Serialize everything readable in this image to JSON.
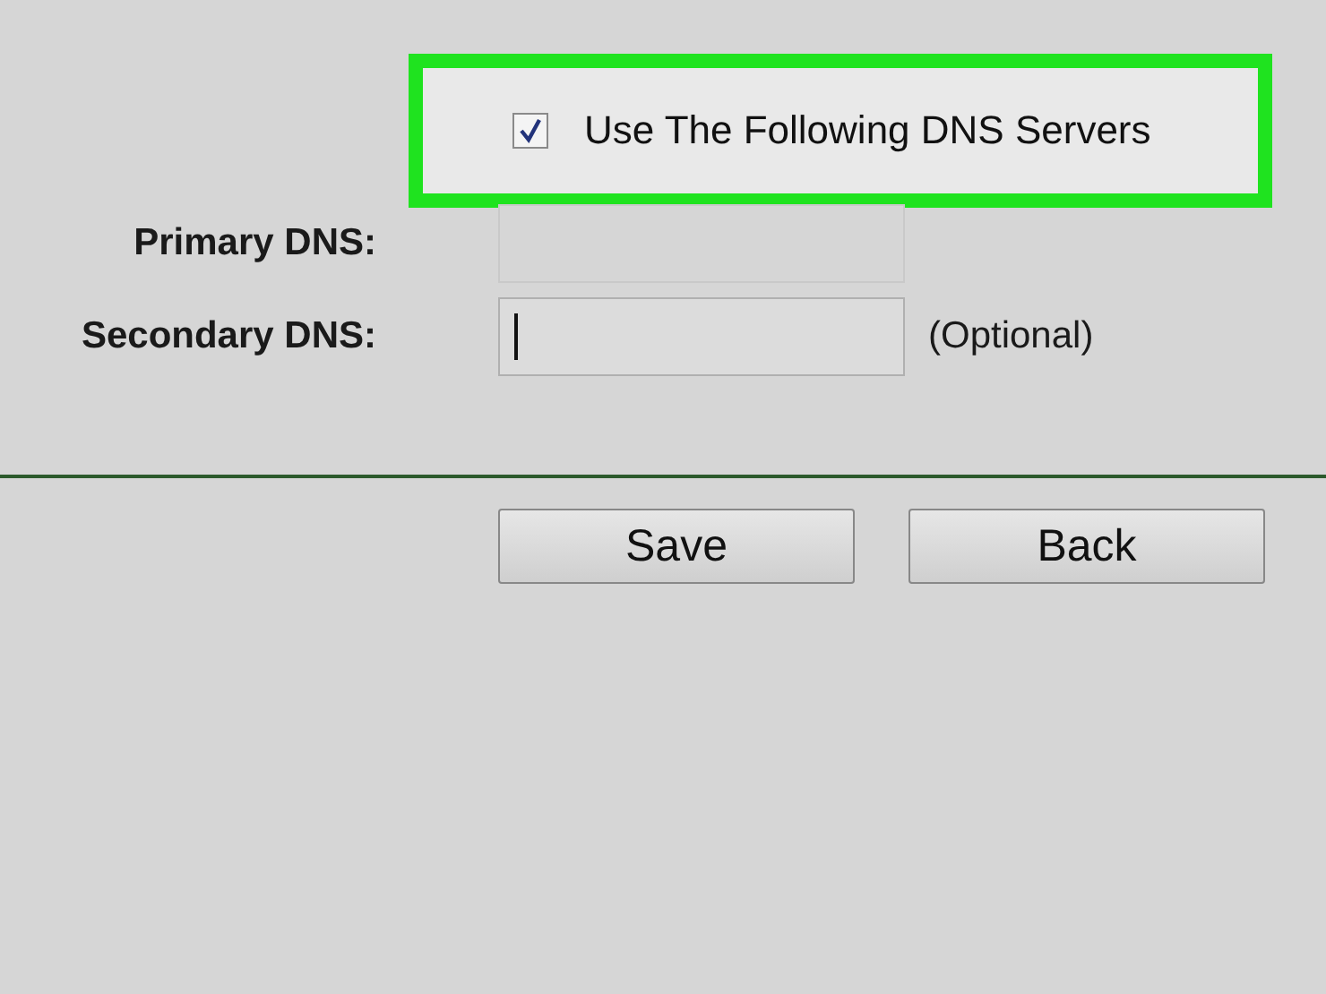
{
  "dns_option": {
    "label": "Use The Following DNS Servers",
    "checked": true,
    "highlighted": true
  },
  "fields": [
    {
      "label": "Primary DNS:",
      "focused": false
    },
    {
      "label": "Secondary DNS:",
      "focused": true,
      "note": "(Optional)"
    }
  ],
  "buttons": [
    "Save",
    "Back"
  ]
}
